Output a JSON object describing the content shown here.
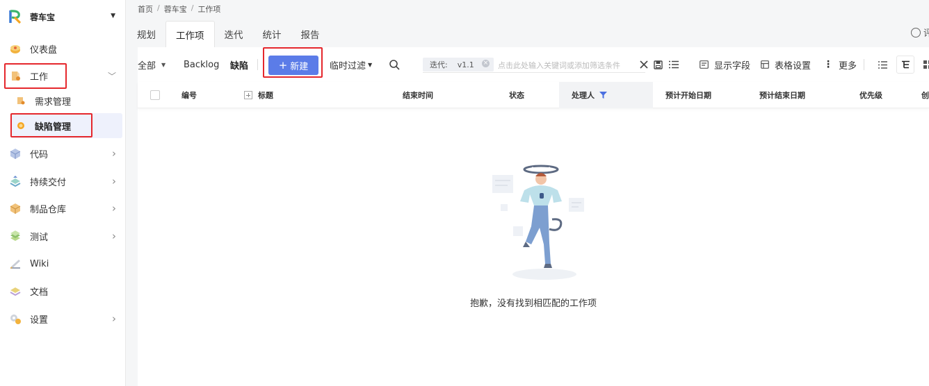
{
  "sidebar": {
    "brand": "蓉车宝",
    "items": [
      {
        "label": "仪表盘"
      },
      {
        "label": "工作"
      },
      {
        "label": "代码"
      },
      {
        "label": "持续交付"
      },
      {
        "label": "制品仓库"
      },
      {
        "label": "测试"
      },
      {
        "label": "Wiki"
      },
      {
        "label": "文档"
      },
      {
        "label": "设置"
      }
    ],
    "sub_items": [
      {
        "label": "需求管理"
      },
      {
        "label": "缺陷管理"
      }
    ]
  },
  "breadcrumb": [
    "首页",
    "蓉车宝",
    "工作项"
  ],
  "rating_label": "评价",
  "tabs": [
    {
      "label": "规划"
    },
    {
      "label": "工作项"
    },
    {
      "label": "迭代"
    },
    {
      "label": "统计"
    },
    {
      "label": "报告"
    }
  ],
  "toolbar": {
    "all": "全部",
    "backlog": "Backlog",
    "defect": "缺陷",
    "new_button": "新建",
    "temp_filter": "临时过滤",
    "chip_label": "迭代:",
    "chip_value": "v1.1",
    "search_placeholder": "点击此处输入关键词或添加筛选条件",
    "show_fields": "显示字段",
    "table_settings": "表格设置",
    "more": "更多"
  },
  "table": {
    "columns": [
      "编号",
      "标题",
      "结束时间",
      "状态",
      "处理人",
      "预计开始日期",
      "预计结束日期",
      "优先级",
      "创"
    ]
  },
  "empty_message": "抱歉，没有找到相匹配的工作项",
  "colors": {
    "primary": "#5b7ce8",
    "highlight": "#e5272c",
    "active_bg": "#eef1fc"
  }
}
